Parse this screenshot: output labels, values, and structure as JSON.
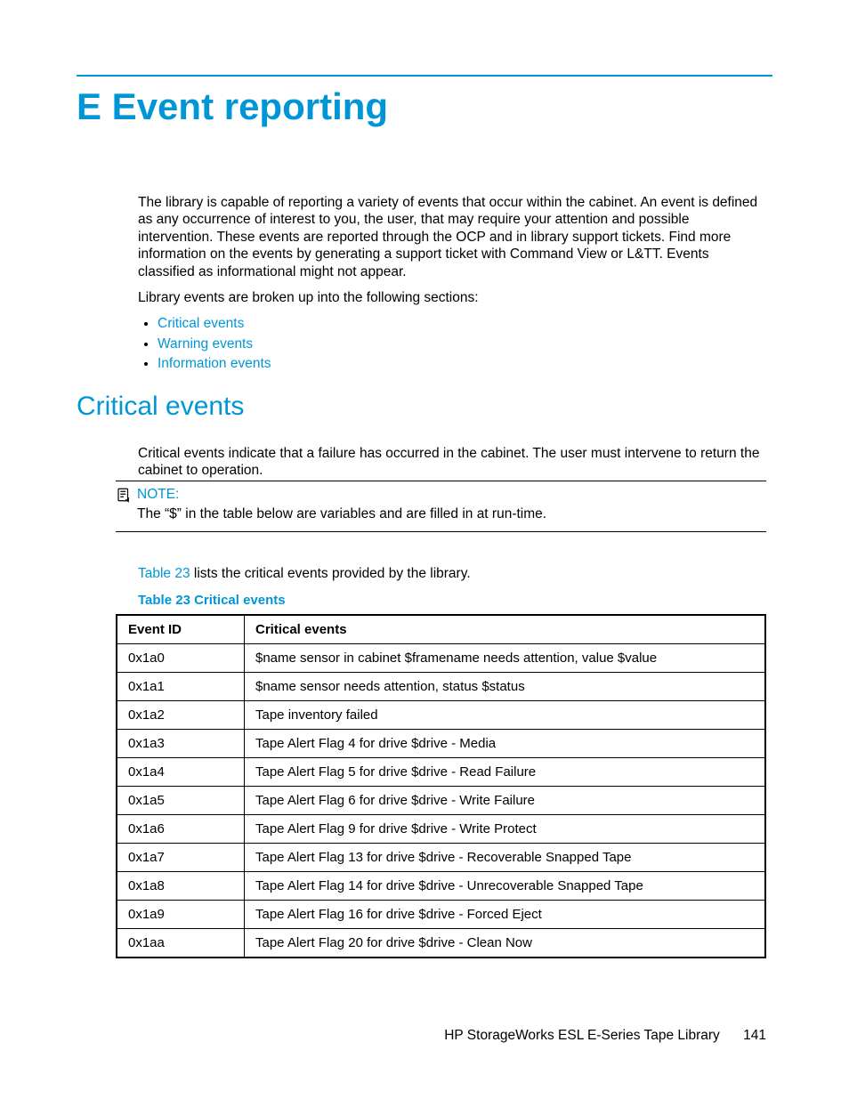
{
  "chapter": {
    "title": "E Event reporting"
  },
  "intro": {
    "p1": "The library is capable of reporting a variety of events that occur within the cabinet. An event is defined as any occurrence of interest to you, the user, that may require your attention and possible intervention. These events are reported through the OCP and in library support tickets. Find more information on the events by generating a support ticket with Command View or L&TT. Events classified as informational might not appear.",
    "p2": "Library events are broken up into the following sections:",
    "links": {
      "critical": "Critical events",
      "warning": "Warning events",
      "information": "Information events"
    }
  },
  "section": {
    "title": "Critical events",
    "p1": "Critical events indicate that a failure has occurred in the cabinet. The user must intervene to return the cabinet to operation."
  },
  "note": {
    "label": "NOTE:",
    "text": "The “$” in the table below are variables and are filled in at run-time."
  },
  "after_note": {
    "tref": "Table 23",
    "rest": " lists the critical events provided by the library."
  },
  "table": {
    "caption": "Table 23 Critical events",
    "headers": {
      "id": "Event ID",
      "desc": "Critical events"
    },
    "rows": [
      {
        "id": "0x1a0",
        "desc": "$name sensor in cabinet $framename needs attention, value $value"
      },
      {
        "id": "0x1a1",
        "desc": "$name sensor needs attention, status $status"
      },
      {
        "id": "0x1a2",
        "desc": "Tape inventory failed"
      },
      {
        "id": "0x1a3",
        "desc": "Tape Alert Flag 4 for drive $drive - Media"
      },
      {
        "id": "0x1a4",
        "desc": "Tape Alert Flag 5 for drive $drive - Read Failure"
      },
      {
        "id": "0x1a5",
        "desc": "Tape Alert Flag 6 for drive $drive - Write Failure"
      },
      {
        "id": "0x1a6",
        "desc": "Tape Alert Flag 9 for drive $drive - Write Protect"
      },
      {
        "id": "0x1a7",
        "desc": "Tape Alert Flag 13 for drive $drive - Recoverable Snapped Tape"
      },
      {
        "id": "0x1a8",
        "desc": "Tape Alert Flag 14 for drive $drive - Unrecoverable Snapped Tape"
      },
      {
        "id": "0x1a9",
        "desc": "Tape Alert Flag 16 for drive $drive - Forced Eject"
      },
      {
        "id": "0x1aa",
        "desc": "Tape Alert Flag 20 for drive $drive - Clean Now"
      }
    ]
  },
  "footer": {
    "doc": "HP StorageWorks ESL E-Series Tape Library",
    "page": "141"
  }
}
